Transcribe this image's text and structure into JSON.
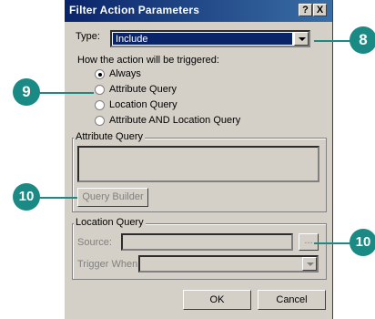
{
  "dialog": {
    "title": "Filter Action Parameters",
    "help_glyph": "?",
    "close_glyph": "X",
    "type_label": "Type:",
    "type_value": "Include",
    "trigger_heading": "How the action will be triggered:",
    "radio_options": [
      {
        "label": "Always",
        "selected": true
      },
      {
        "label": "Attribute Query",
        "selected": false
      },
      {
        "label": "Location Query",
        "selected": false
      },
      {
        "label": "Attribute AND Location Query",
        "selected": false
      }
    ],
    "attribute_group_label": "Attribute Query",
    "query_builder_label": "Query Builder",
    "location_group_label": "Location Query",
    "source_label": "Source:",
    "source_browse_label": "...",
    "trigger_when_label": "Trigger When:",
    "ok_label": "OK",
    "cancel_label": "Cancel"
  },
  "callouts": {
    "c8": "8",
    "c9": "9",
    "c10a": "10",
    "c10b": "10"
  },
  "colors": {
    "callout": "#1b8a84",
    "titlebar_start": "#0a246a",
    "titlebar_end": "#3a6ea5",
    "dialog_face": "#d4d0c8"
  }
}
